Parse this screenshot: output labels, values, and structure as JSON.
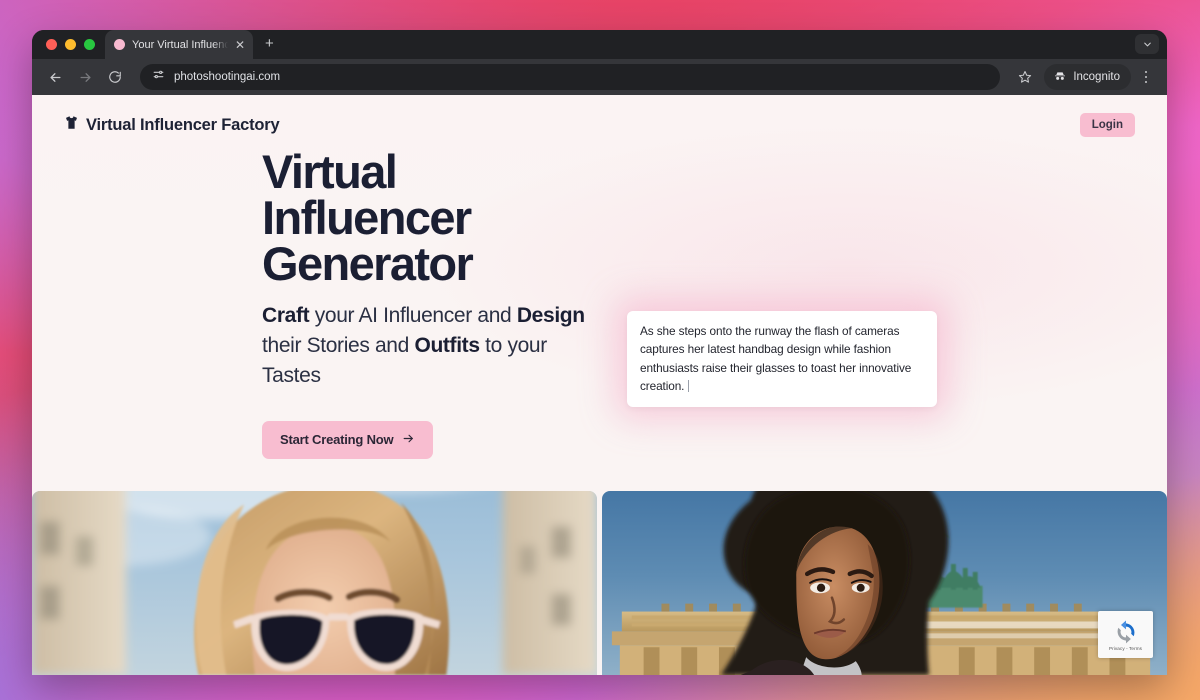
{
  "browser": {
    "tab": {
      "title": "Your Virtual Influencer Factory",
      "close_label": "✕",
      "favicon": "pink-circle-favicon"
    },
    "new_tab_label": "+",
    "tab_list_chevron": "chevron-down-icon",
    "toolbar": {
      "back": "back-arrow-icon",
      "forward": "forward-arrow-icon",
      "reload": "reload-icon",
      "site_settings_icon": "tune-sliders-icon",
      "url": "photoshootingai.com",
      "bookmark": "star-icon",
      "incognito_label": "Incognito",
      "incognito_icon": "incognito-hat-icon",
      "menu": "three-dot-menu-icon"
    }
  },
  "site": {
    "brand": {
      "icon": "tshirt-icon",
      "name": "Virtual Influencer Factory"
    },
    "login_label": "Login",
    "hero": {
      "title_lines": [
        "Virtual",
        "Influencer",
        "Generator"
      ],
      "sub_parts": [
        {
          "text": "Craft",
          "bold": true
        },
        {
          "text": " your AI Influencer and ",
          "bold": false
        },
        {
          "text": "Design",
          "bold": true
        },
        {
          "text": " their Stories and ",
          "bold": false
        },
        {
          "text": "Outfits",
          "bold": true
        },
        {
          "text": " to your Tastes",
          "bold": false
        }
      ],
      "cta_label": "Start Creating Now",
      "cta_icon": "arrow-right-icon"
    },
    "prompt_card": {
      "text": "As she steps onto the runway the flash of cameras captures her latest handbag design while fashion enthusiasts raise their glasses to toast her innovative creation."
    },
    "gallery": [
      {
        "alt": "blonde-woman-sunglasses-paris-street"
      },
      {
        "alt": "woman-afro-hair-brandenburg-gate-berlin"
      }
    ],
    "recaptcha": {
      "label": "Privacy - Terms",
      "icon": "recaptcha-icon"
    }
  },
  "theme": {
    "accent_pink": "#f8bdd0",
    "ink": "#1b1f33",
    "page_bg": "#faf4f3",
    "browser_chrome": "#35363a"
  }
}
